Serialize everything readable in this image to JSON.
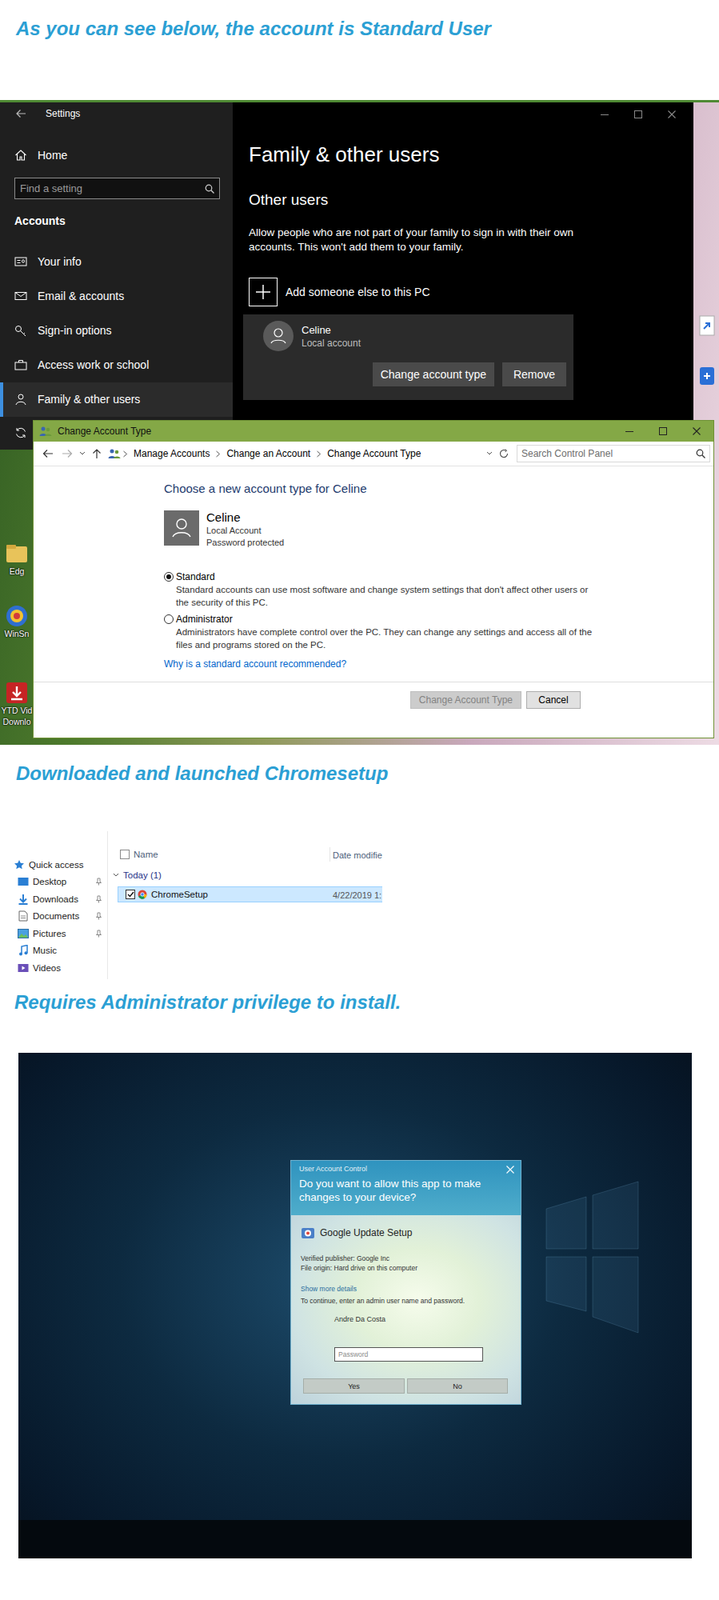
{
  "captions": [
    "As you can see below, the account is Standard User",
    "Downloaded and launched Chromesetup",
    "Requires Administrator privilege to install."
  ],
  "settings": {
    "title": "Settings",
    "home": "Home",
    "search": {
      "placeholder": "Find a setting"
    },
    "section": "Accounts",
    "nav": [
      {
        "label": "Your info",
        "selected": false
      },
      {
        "label": "Email & accounts",
        "selected": false
      },
      {
        "label": "Sign-in options",
        "selected": false
      },
      {
        "label": "Access work or school",
        "selected": false
      },
      {
        "label": "Family & other users",
        "selected": true
      }
    ],
    "page": {
      "title": "Family & other users",
      "section": "Other users",
      "description": "Allow people who are not part of your family to sign in with their own accounts. This won't add them to your family.",
      "add_label": "Add someone else to this PC",
      "user": {
        "name": "Celine",
        "type": "Local account"
      },
      "buttons": [
        "Change account type",
        "Remove"
      ]
    }
  },
  "change_account_window": {
    "title": "Change Account Type",
    "breadcrumb": [
      "Manage Accounts",
      "Change an Account",
      "Change Account Type"
    ],
    "search": {
      "placeholder": "Search Control Panel"
    },
    "heading": "Choose a new account type for Celine",
    "account": {
      "name": "Celine",
      "lines": [
        "Local Account",
        "Password protected"
      ]
    },
    "options": [
      {
        "label": "Standard",
        "description": "Standard accounts can use most software and change system settings that don't affect other users or the security of this PC.",
        "selected": true
      },
      {
        "label": "Administrator",
        "description": "Administrators have complete control over the PC. They can change any settings and access all of the files and programs stored on the PC.",
        "selected": false
      }
    ],
    "link": "Why is a standard account recommended?",
    "buttons": [
      {
        "label": "Change Account Type",
        "disabled": true
      },
      {
        "label": "Cancel",
        "disabled": false
      }
    ]
  },
  "desktop_icons": [
    {
      "lines": [
        "Edg"
      ]
    },
    {
      "lines": [
        "WinSn"
      ]
    },
    {
      "lines": [
        "YTD Vid",
        "Downlo"
      ]
    }
  ],
  "explorer": {
    "nav": [
      {
        "label": "Quick access",
        "pinned": false
      },
      {
        "label": "Desktop",
        "pinned": true
      },
      {
        "label": "Downloads",
        "pinned": true
      },
      {
        "label": "Documents",
        "pinned": true
      },
      {
        "label": "Pictures",
        "pinned": true
      },
      {
        "label": "Music",
        "pinned": false
      },
      {
        "label": "Videos",
        "pinned": false
      }
    ],
    "select_all": {
      "checked": false
    },
    "columns": [
      "Name",
      "Date modifie"
    ],
    "group": "Today (1)",
    "rows": [
      {
        "name": "ChromeSetup",
        "date": "4/22/2019 1:",
        "selected": true,
        "checked": true
      }
    ]
  },
  "uac": {
    "title": "User Account Control",
    "question": "Do you want to allow this app to make changes to your device?",
    "app": "Google Update Setup",
    "details": [
      "Verified publisher: Google Inc",
      "File origin: Hard drive on this computer"
    ],
    "more": "Show more details",
    "prompt": "To continue, enter an admin user name and password.",
    "user": "Andre Da Costa",
    "password": {
      "placeholder": "Password"
    },
    "buttons": [
      "Yes",
      "No"
    ]
  }
}
